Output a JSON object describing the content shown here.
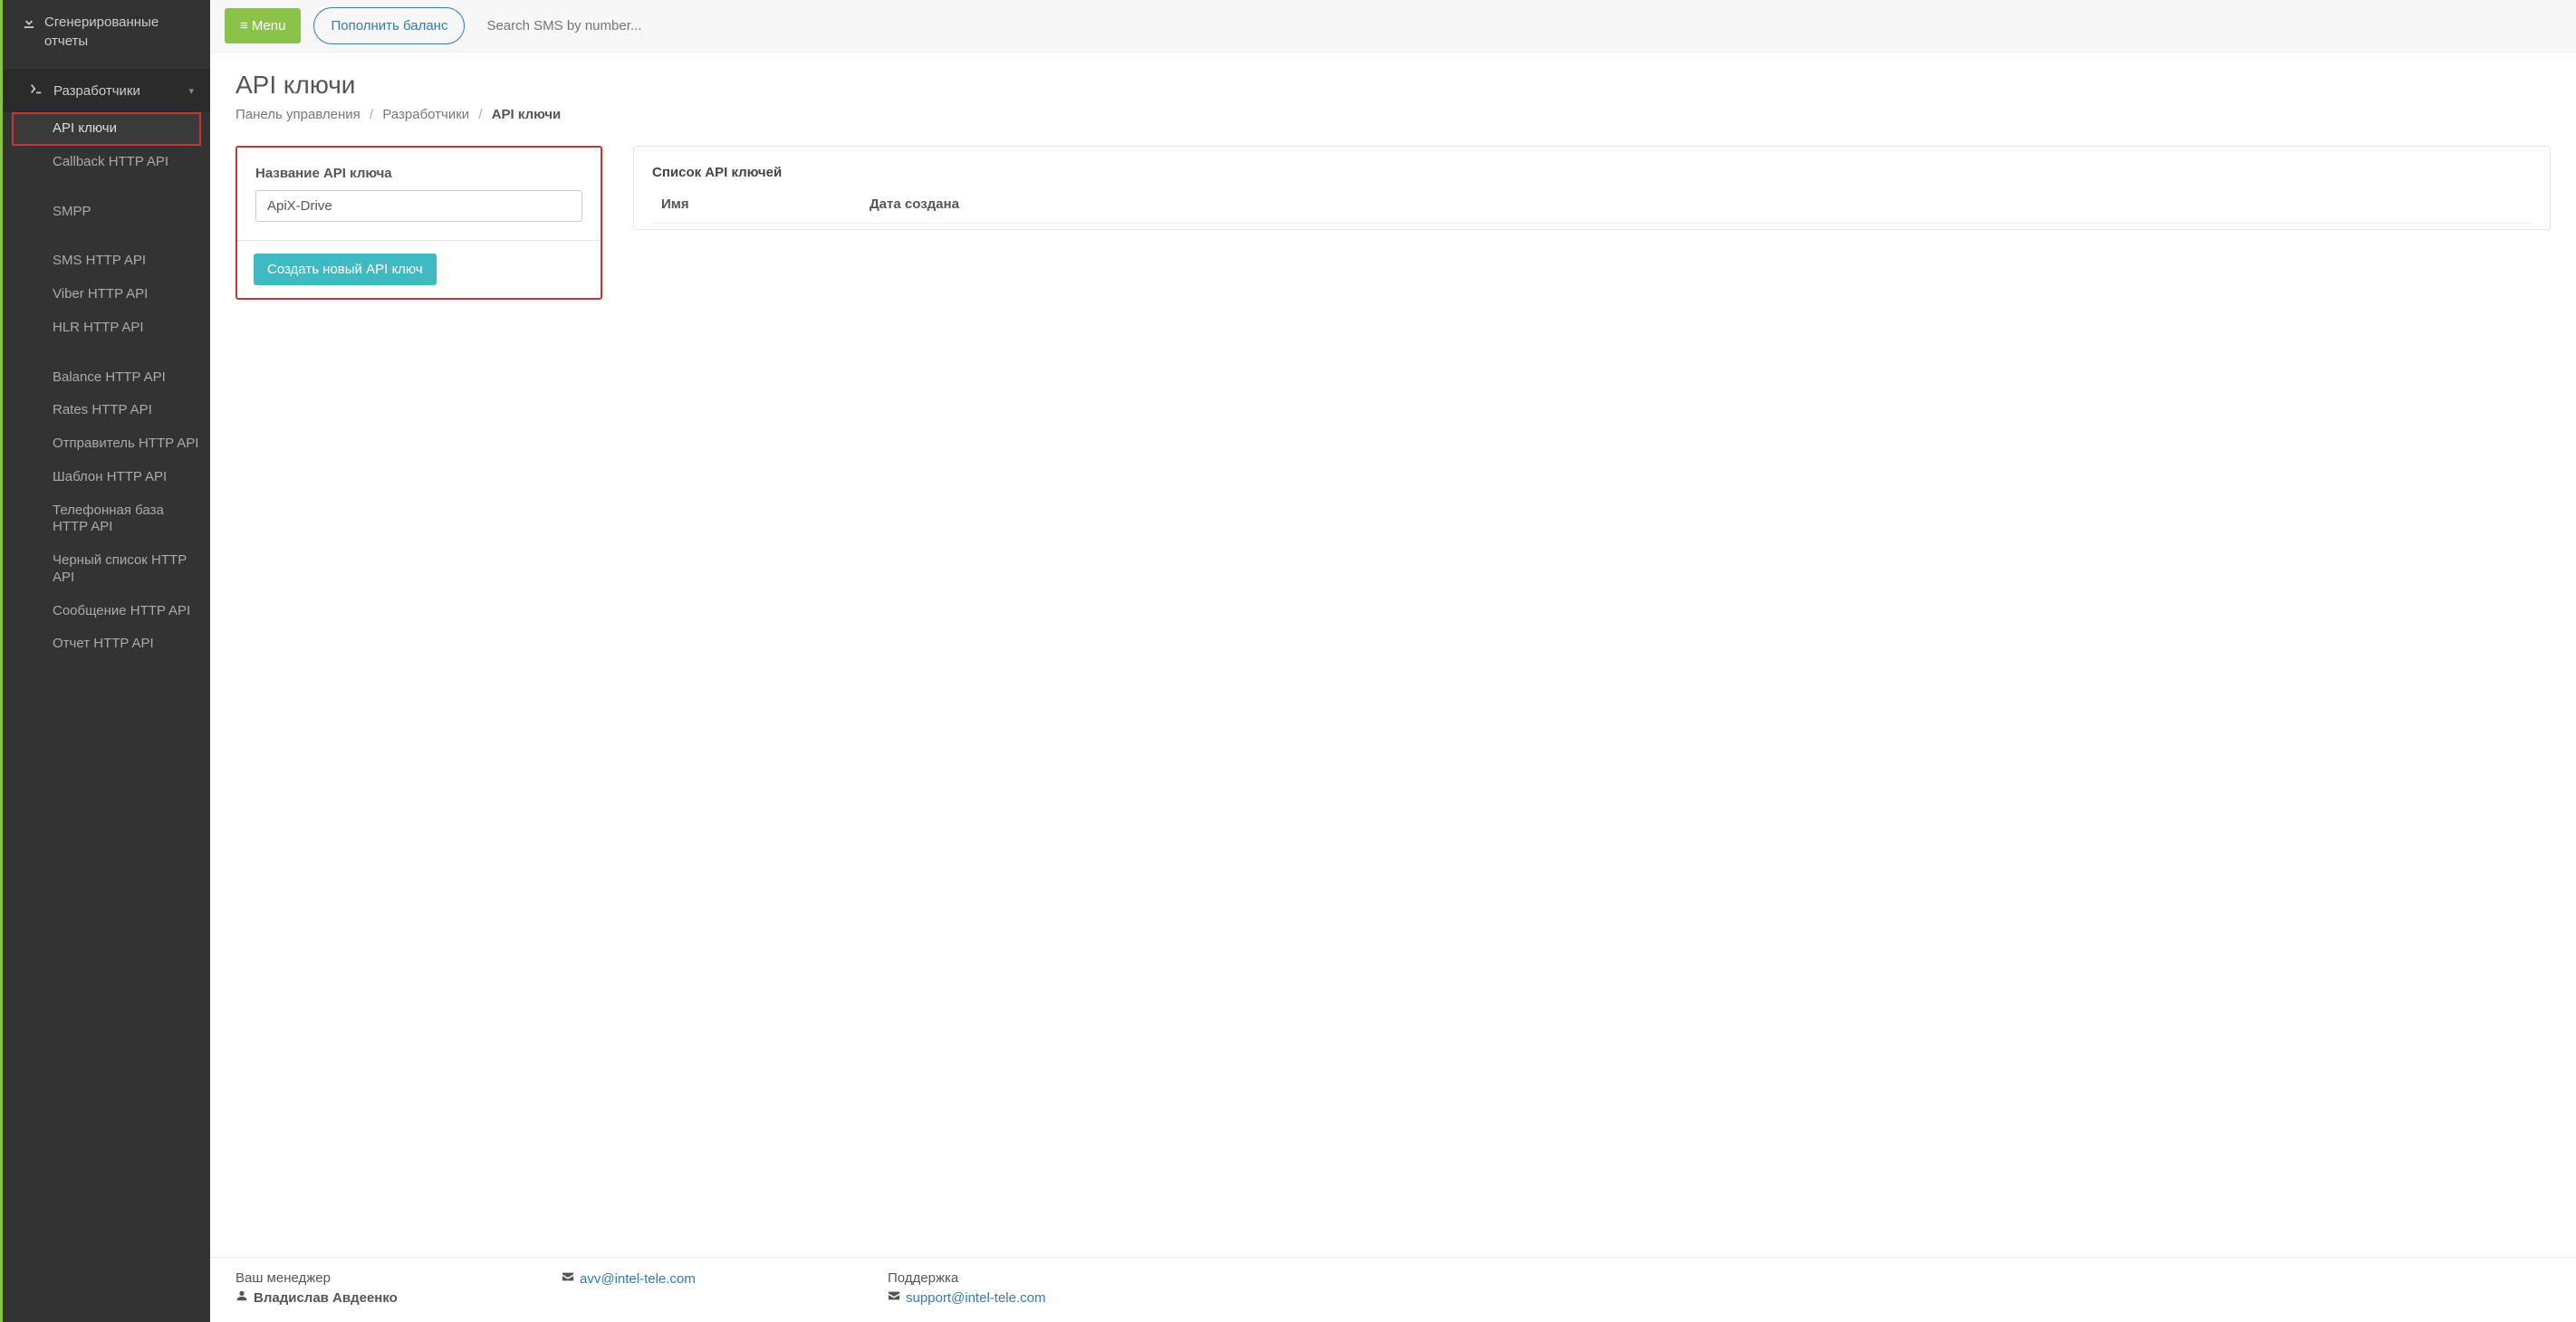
{
  "topbar": {
    "menu_label": "Menu",
    "balance_label": "Пополнить баланс",
    "search_placeholder": "Search SMS by number..."
  },
  "sidebar": {
    "reports_label": "Сгенерированные отчеты",
    "section_label": "Разработчики",
    "items": [
      "API ключи",
      "Callback HTTP API",
      "SMPP",
      "SMS HTTP API",
      "Viber HTTP API",
      "HLR HTTP API",
      "Balance HTTP API",
      "Rates HTTP API",
      "Отправитель HTTP API",
      "Шаблон HTTP API",
      "Телефонная база HTTP API",
      "Черный список HTTP API",
      "Сообщение HTTP API",
      "Отчет HTTP API"
    ]
  },
  "page": {
    "title": "API ключи",
    "breadcrumb": {
      "dashboard": "Панель управления",
      "developers": "Разработчики",
      "current": "API ключи"
    }
  },
  "create_panel": {
    "label": "Название API ключа",
    "value": "ApiX-Drive",
    "button": "Создать новый API ключ"
  },
  "list_panel": {
    "title": "Список API ключей",
    "col_name": "Имя",
    "col_date": "Дата создана"
  },
  "footer": {
    "manager_label": "Ваш менеджер",
    "manager_name": "Владислав Авдеенко",
    "manager_email": "avv@intel-tele.com",
    "support_label": "Поддержка",
    "support_email": "support@intel-tele.com"
  }
}
